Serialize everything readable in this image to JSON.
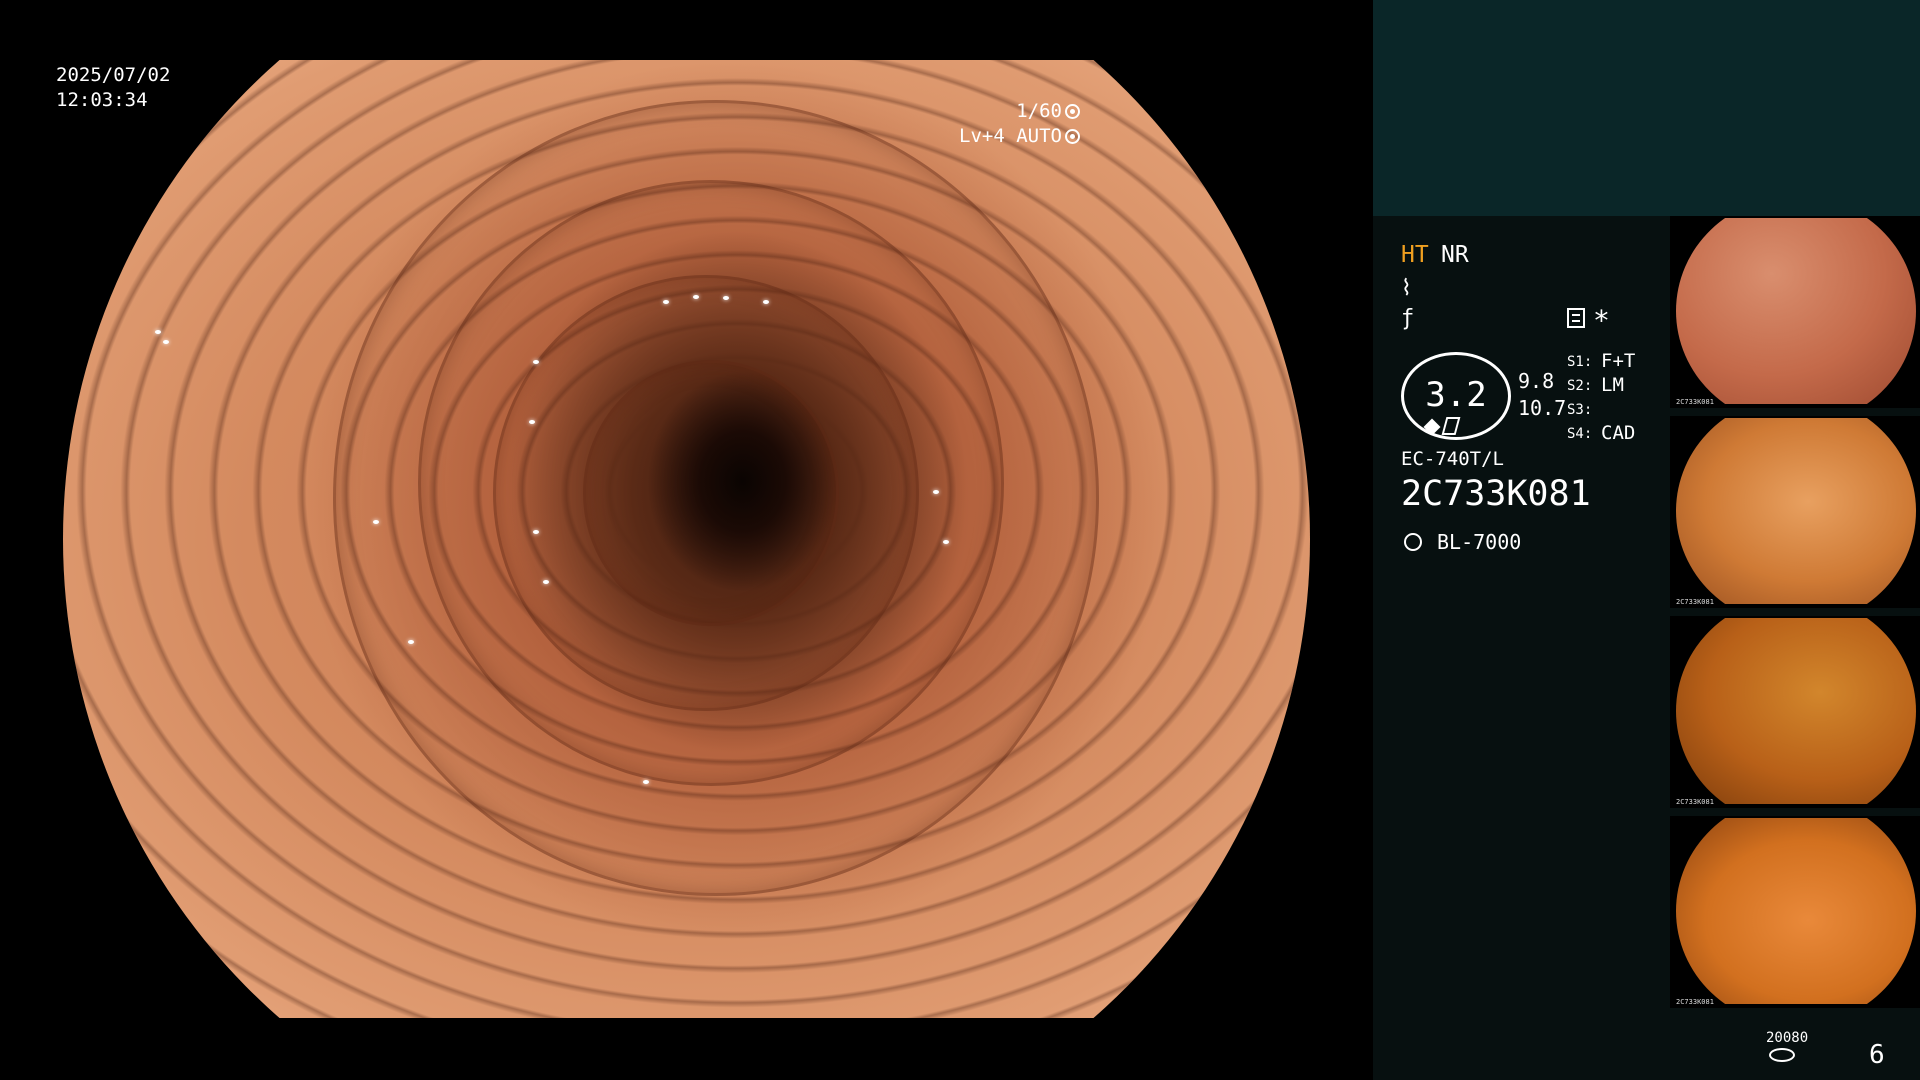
{
  "osd": {
    "date": "2025/07/02",
    "time": "12:03:34",
    "shutter": "1/60",
    "exposure": "Lv+4 AUTO"
  },
  "panel": {
    "ht": "HT",
    "nr": "NR",
    "icon_a": "wave-icon",
    "icon_b": "fn-icon",
    "asterisk": "*",
    "zoom_value": "3.2",
    "val_1": "9.8",
    "val_2": "10.7",
    "settings": [
      {
        "label": "S1:",
        "value": "F+T"
      },
      {
        "label": "S2:",
        "value": "LM"
      },
      {
        "label": "S3:",
        "value": ""
      },
      {
        "label": "S4:",
        "value": "CAD"
      }
    ],
    "scope_model": "EC-740T/L",
    "serial": "2C733K081",
    "light_source": "BL-7000",
    "light_icon": "sun-icon"
  },
  "thumbnails": [
    {
      "label": "2C733K081"
    },
    {
      "label": "2C733K081"
    },
    {
      "label": "2C733K081"
    },
    {
      "label": "2C733K081"
    }
  ],
  "footer": {
    "storage_value": "20080",
    "image_count": "6"
  },
  "colors": {
    "ht_accent": "#f0a020",
    "panel_top": "#0a2628",
    "panel_bg": "#071010"
  }
}
